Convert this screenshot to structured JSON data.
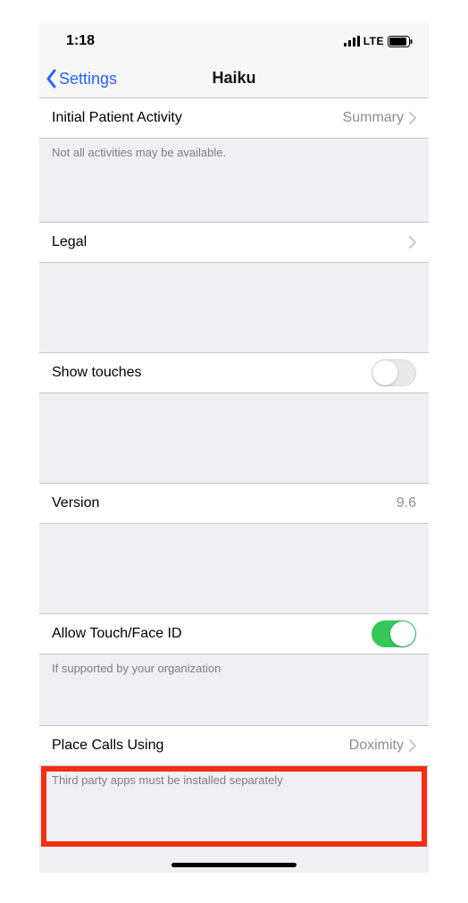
{
  "status": {
    "time": "1:18",
    "network": "LTE"
  },
  "nav": {
    "back_label": "Settings",
    "title": "Haiku"
  },
  "rows": {
    "initial_activity": {
      "label": "Initial Patient Activity",
      "value": "Summary"
    },
    "initial_activity_note": "Not all activities may be available.",
    "legal": {
      "label": "Legal"
    },
    "show_touches": {
      "label": "Show touches",
      "on": false
    },
    "version": {
      "label": "Version",
      "value": "9.6"
    },
    "allow_touch_face_id": {
      "label": "Allow Touch/Face ID",
      "on": true
    },
    "allow_touch_face_id_note": "If supported by your organization",
    "place_calls": {
      "label": "Place Calls Using",
      "value": "Doximity"
    },
    "place_calls_note": "Third party apps must be installed separately"
  }
}
